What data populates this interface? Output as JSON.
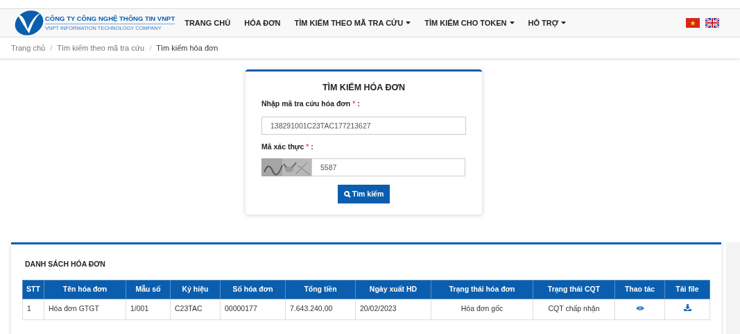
{
  "navbar": {
    "company_name": "CÔNG TY CÔNG NGHỆ THÔNG TIN VNPT",
    "company_subtitle": "VNPT INFORMATION TECHNOLOGY COMPANY",
    "menu": [
      {
        "label": "TRANG CHỦ",
        "dropdown": false
      },
      {
        "label": "HÓA ĐƠN",
        "dropdown": false
      },
      {
        "label": "TÌM KIẾM THEO MÃ TRA CỨU",
        "dropdown": true
      },
      {
        "label": "TÌM KIẾM CHO TOKEN",
        "dropdown": true
      },
      {
        "label": "HỖ TRỢ",
        "dropdown": true
      }
    ]
  },
  "breadcrumb_separator": "/",
  "breadcrumb": [
    {
      "label": "Trang chủ",
      "current": false
    },
    {
      "label": "Tìm kiếm theo mã tra cứu",
      "current": false
    },
    {
      "label": "Tìm kiếm hóa đơn",
      "current": true
    }
  ],
  "search_form": {
    "title": "TÌM KIẾM HÓA ĐƠN",
    "lookup_label": "Nhập mã tra cứu hóa đơn",
    "lookup_value": "138291001C23TAC177213627",
    "captcha_label": "Mã xác thực",
    "captcha_value": "5587",
    "required_mark": "*",
    "colon": ":",
    "button": "Tìm kiếm"
  },
  "table": {
    "title": "DANH SÁCH HÓA ĐƠN",
    "columns": [
      "STT",
      "Tên hóa đơn",
      "Mẫu số",
      "Ký hiệu",
      "Số hóa đơn",
      "Tổng tiền",
      "Ngày xuất HD",
      "Trạng thái hóa đơn",
      "Trạng thái CQT",
      "Thao tác",
      "Tải file"
    ],
    "rows": [
      {
        "cells": [
          "1",
          "Hóa đơn GTGT",
          "1/001",
          "C23TAC",
          "00000177",
          "7.643.240,00",
          "20/02/2023",
          "Hóa đơn gốc",
          "CQT chấp nhận"
        ]
      }
    ]
  }
}
